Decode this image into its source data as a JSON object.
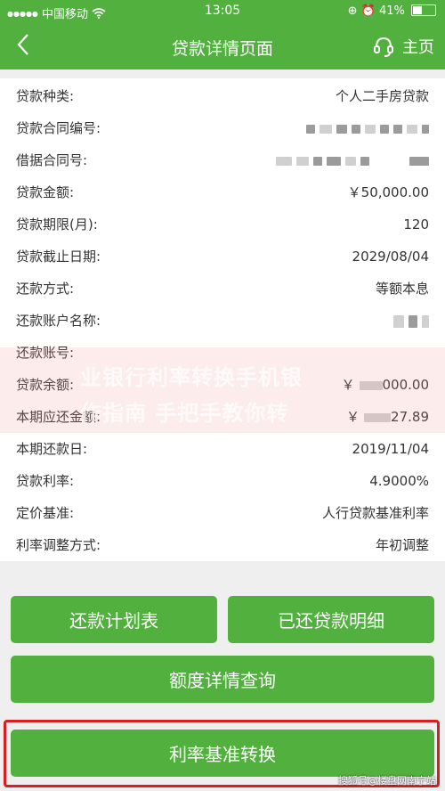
{
  "status_bar": {
    "signal": "●●●●●",
    "carrier": "中国移动",
    "wifi_icon": "wifi-icon",
    "time": "13:05",
    "icons": "⊕ ⏰",
    "battery_percent": "41%"
  },
  "nav": {
    "back": "〈",
    "title": "贷款详情页面",
    "home_label": "主页"
  },
  "details": [
    {
      "label": "贷款种类:",
      "value": "个人二手房贷款"
    },
    {
      "label": "贷款合同编号:",
      "value": ""
    },
    {
      "label": "借据合同号:",
      "value": ""
    },
    {
      "label": "贷款金额:",
      "value": "￥50,000.00"
    },
    {
      "label": "贷款期限(月):",
      "value": "120"
    },
    {
      "label": "贷款截止日期:",
      "value": "2029/08/04"
    },
    {
      "label": "还款方式:",
      "value": "等额本息"
    },
    {
      "label": "还款账户名称:",
      "value": ""
    },
    {
      "label": "还款账号:",
      "value": ""
    },
    {
      "label": "贷款余额:",
      "value": "￥",
      "value_tail": "000.00"
    },
    {
      "label": "本期应还金额:",
      "value": "￥",
      "value_tail": "27.89"
    },
    {
      "label": "本期还款日:",
      "value": "2019/11/04"
    },
    {
      "label": "贷款利率:",
      "value": "4.9000%"
    },
    {
      "label": "定价基准:",
      "value": "人行贷款基准利率"
    },
    {
      "label": "利率调整方式:",
      "value": "年初调整"
    }
  ],
  "watermark": {
    "line1": "业银行利率转换手机银",
    "line2": "作指南 手把手教你转"
  },
  "buttons": {
    "repayment_plan": "还款计划表",
    "repaid_details": "已还贷款明细",
    "quota_query": "额度详情查询",
    "rate_conversion": "利率基准转换"
  },
  "credit": "搜狐号@楼盘网南宁站",
  "colors": {
    "brand_green": "#52b03f",
    "highlight_red": "#d81e1e"
  }
}
